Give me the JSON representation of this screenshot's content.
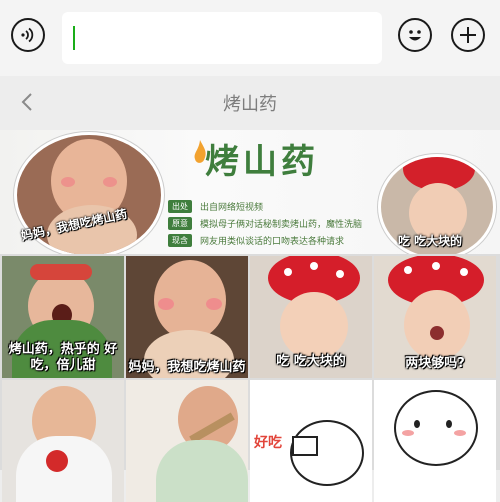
{
  "topbar": {
    "voice_icon": "voice-icon",
    "emoji_icon": "emoji-icon",
    "add_icon": "plus-icon",
    "input_value": ""
  },
  "nav": {
    "back_icon": "chevron-left-icon",
    "title": "烤山药"
  },
  "banner": {
    "title": "烤山药",
    "left_caption": "妈妈，我想吃烤山药",
    "right_caption": "吃 吃大块的",
    "rows": [
      {
        "tag": "出处",
        "text": "出自网络短视频"
      },
      {
        "tag": "原意",
        "text": "模拟母子俩对话秘制卖烤山药，魔性洗脑"
      },
      {
        "tag": "现含",
        "text": "网友用类似谈话的口吻表达各种请求"
      }
    ]
  },
  "stickers": [
    {
      "caption": "烤山药，热乎的 好吃，倍儿甜"
    },
    {
      "caption": "妈妈，我想吃烤山药"
    },
    {
      "caption": "吃 吃大块的"
    },
    {
      "caption": "两块够吗?"
    },
    {
      "caption": ""
    },
    {
      "caption": ""
    },
    {
      "caption": "好吃"
    },
    {
      "caption": ""
    }
  ],
  "colors": {
    "accent_green": "#3f7e3d",
    "caret_green": "#1aad19"
  }
}
